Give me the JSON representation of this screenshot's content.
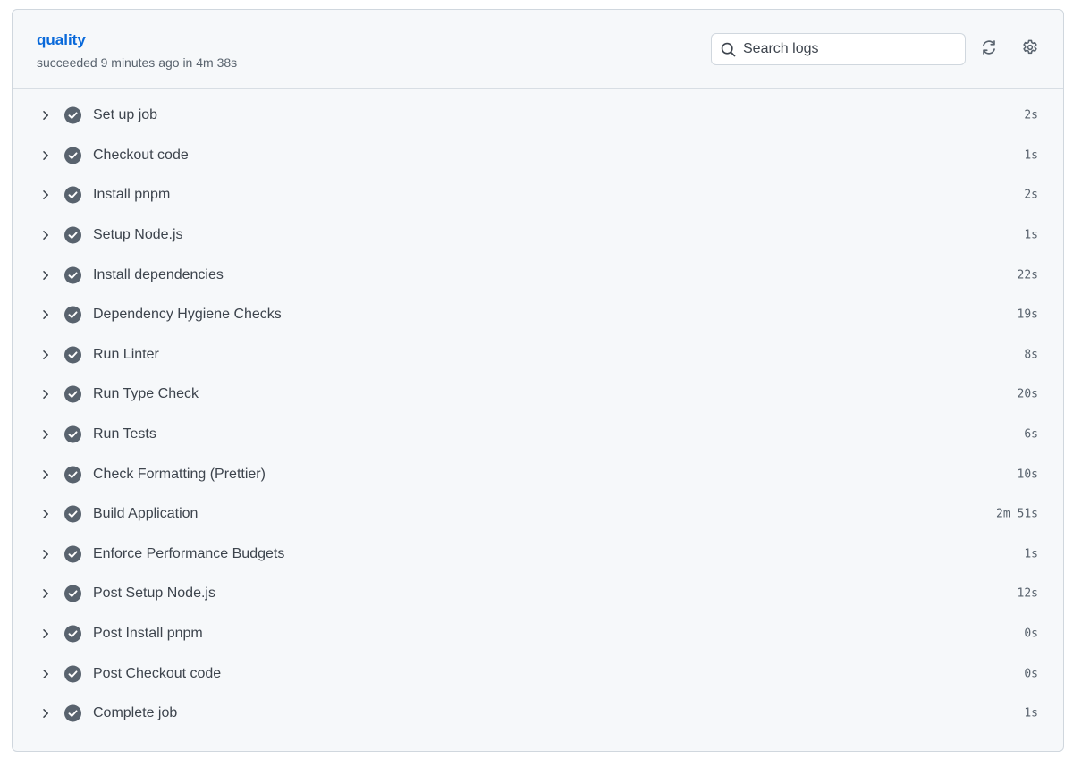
{
  "job": {
    "title": "quality",
    "subtitle": "succeeded 9 minutes ago in 4m 38s"
  },
  "search": {
    "placeholder": "Search logs",
    "value": ""
  },
  "toolbar": {
    "refresh_icon": "sync-icon",
    "settings_icon": "gear-icon"
  },
  "colors": {
    "title_link": "#0969da",
    "success_icon": "#59636e",
    "panel_bg": "#f6f8fa"
  },
  "steps": [
    {
      "name": "Set up job",
      "duration": "2s",
      "status": "success"
    },
    {
      "name": "Checkout code",
      "duration": "1s",
      "status": "success"
    },
    {
      "name": "Install pnpm",
      "duration": "2s",
      "status": "success"
    },
    {
      "name": "Setup Node.js",
      "duration": "1s",
      "status": "success"
    },
    {
      "name": "Install dependencies",
      "duration": "22s",
      "status": "success"
    },
    {
      "name": "Dependency Hygiene Checks",
      "duration": "19s",
      "status": "success"
    },
    {
      "name": "Run Linter",
      "duration": "8s",
      "status": "success"
    },
    {
      "name": "Run Type Check",
      "duration": "20s",
      "status": "success"
    },
    {
      "name": "Run Tests",
      "duration": "6s",
      "status": "success"
    },
    {
      "name": "Check Formatting (Prettier)",
      "duration": "10s",
      "status": "success"
    },
    {
      "name": "Build Application",
      "duration": "2m 51s",
      "status": "success"
    },
    {
      "name": "Enforce Performance Budgets",
      "duration": "1s",
      "status": "success"
    },
    {
      "name": "Post Setup Node.js",
      "duration": "12s",
      "status": "success"
    },
    {
      "name": "Post Install pnpm",
      "duration": "0s",
      "status": "success"
    },
    {
      "name": "Post Checkout code",
      "duration": "0s",
      "status": "success"
    },
    {
      "name": "Complete job",
      "duration": "1s",
      "status": "success"
    }
  ]
}
